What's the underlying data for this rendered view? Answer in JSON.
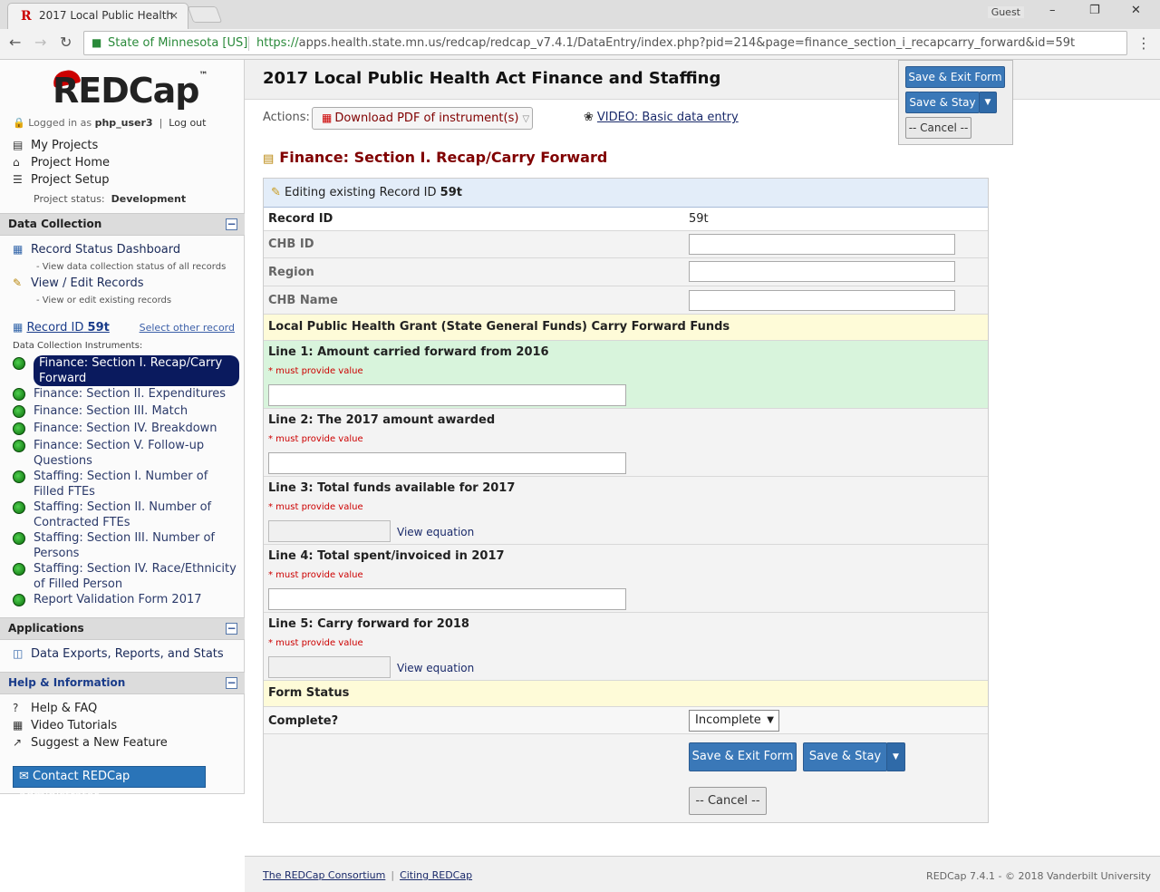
{
  "browser": {
    "tab_title": "2017 Local Public Health",
    "tab_close": "×",
    "favicon": "R",
    "guest": "Guest",
    "minimize": "–",
    "restore": "❐",
    "close": "✕",
    "back": "←",
    "forward": "→",
    "reload": "↻",
    "lock": "🔒",
    "secure_label": "State of Minnesota [US]",
    "url_scheme": "https://",
    "url_rest": "apps.health.state.mn.us/redcap/redcap_v7.4.1/DataEntry/index.php?pid=214&page=finance_section_i_recapcarry_forward&id=59t",
    "menu": "⋮"
  },
  "sidebar": {
    "logo": "REDCap",
    "logo_tm": "™",
    "logged_in_prefix": "Logged in as",
    "username": "php_user3",
    "separator": "|",
    "logout": "Log out",
    "top_links": [
      {
        "label": "My Projects",
        "icon": "▤"
      },
      {
        "label": "Project Home",
        "icon": "⌂"
      },
      {
        "label": "Project Setup",
        "icon": "☰"
      }
    ],
    "project_status_label": "Project status:",
    "project_status_value": "Development",
    "data_collection": {
      "header": "Data Collection",
      "toggle": "−",
      "record_status_dashboard": "Record Status Dashboard",
      "record_status_note": "- View data collection status of all records",
      "view_edit_records": "View / Edit Records",
      "view_edit_note": "- View or edit existing records",
      "record_id_label": "Record ID",
      "record_id_value": "59t",
      "select_other": "Select other record",
      "instruments_label": "Data Collection Instruments:",
      "instruments": [
        "Finance: Section I. Recap/Carry Forward",
        "Finance: Section II. Expenditures",
        "Finance: Section III. Match",
        "Finance: Section IV. Breakdown",
        "Finance: Section V. Follow-up Questions",
        "Staffing: Section I. Number of Filled FTEs",
        "Staffing: Section II. Number of Contracted FTEs",
        "Staffing: Section III. Number of Persons",
        "Staffing: Section IV. Race/Ethnicity of Filled Person",
        "Report Validation Form 2017"
      ]
    },
    "applications": {
      "header": "Applications",
      "toggle": "−",
      "data_exports": "Data Exports, Reports, and Stats"
    },
    "help": {
      "header": "Help & Information",
      "toggle": "−",
      "links": [
        {
          "label": "Help & FAQ",
          "icon": "?"
        },
        {
          "label": "Video Tutorials",
          "icon": "▦"
        },
        {
          "label": "Suggest a New Feature",
          "icon": "↗"
        }
      ],
      "contact": "✉ Contact REDCap administrator"
    }
  },
  "main": {
    "title": "2017 Local Public Health Act Finance and Staffing",
    "actions_label": "Actions:",
    "pdf_button": "Download PDF of instrument(s)",
    "pdf_caret": "▽",
    "video_link": "VIDEO: Basic data entry",
    "float_save_exit": "Save & Exit Form",
    "float_save_stay": "Save & Stay",
    "float_cancel": "-- Cancel --",
    "caret": "▼",
    "form_title": "Finance: Section I. Recap/Carry Forward",
    "editing_prefix": "Editing existing Record ID",
    "editing_id": "59t",
    "record_id_label": "Record ID",
    "record_id_value": "59t",
    "chb_id_label": "CHB ID",
    "region_label": "Region",
    "chb_name_label": "CHB Name",
    "section_header": "Local Public Health Grant (State General Funds) Carry Forward Funds",
    "required_note": "* must provide value",
    "view_equation": "View equation",
    "lines": [
      "Line 1: Amount carried forward from 2016",
      "Line 2: The 2017 amount awarded",
      "Line 3: Total funds available for 2017",
      "Line 4: Total spent/invoiced in 2017",
      "Line 5: Carry forward for 2018"
    ],
    "form_status_header": "Form Status",
    "complete_label": "Complete?",
    "complete_value": "Incomplete",
    "save_exit": "Save & Exit Form",
    "save_stay": "Save & Stay",
    "cancel": "-- Cancel --"
  },
  "footer": {
    "consortium": "The REDCap Consortium",
    "separator": "|",
    "citing": "Citing REDCap",
    "copyright": "REDCap 7.4.1 - © 2018 Vanderbilt University"
  }
}
